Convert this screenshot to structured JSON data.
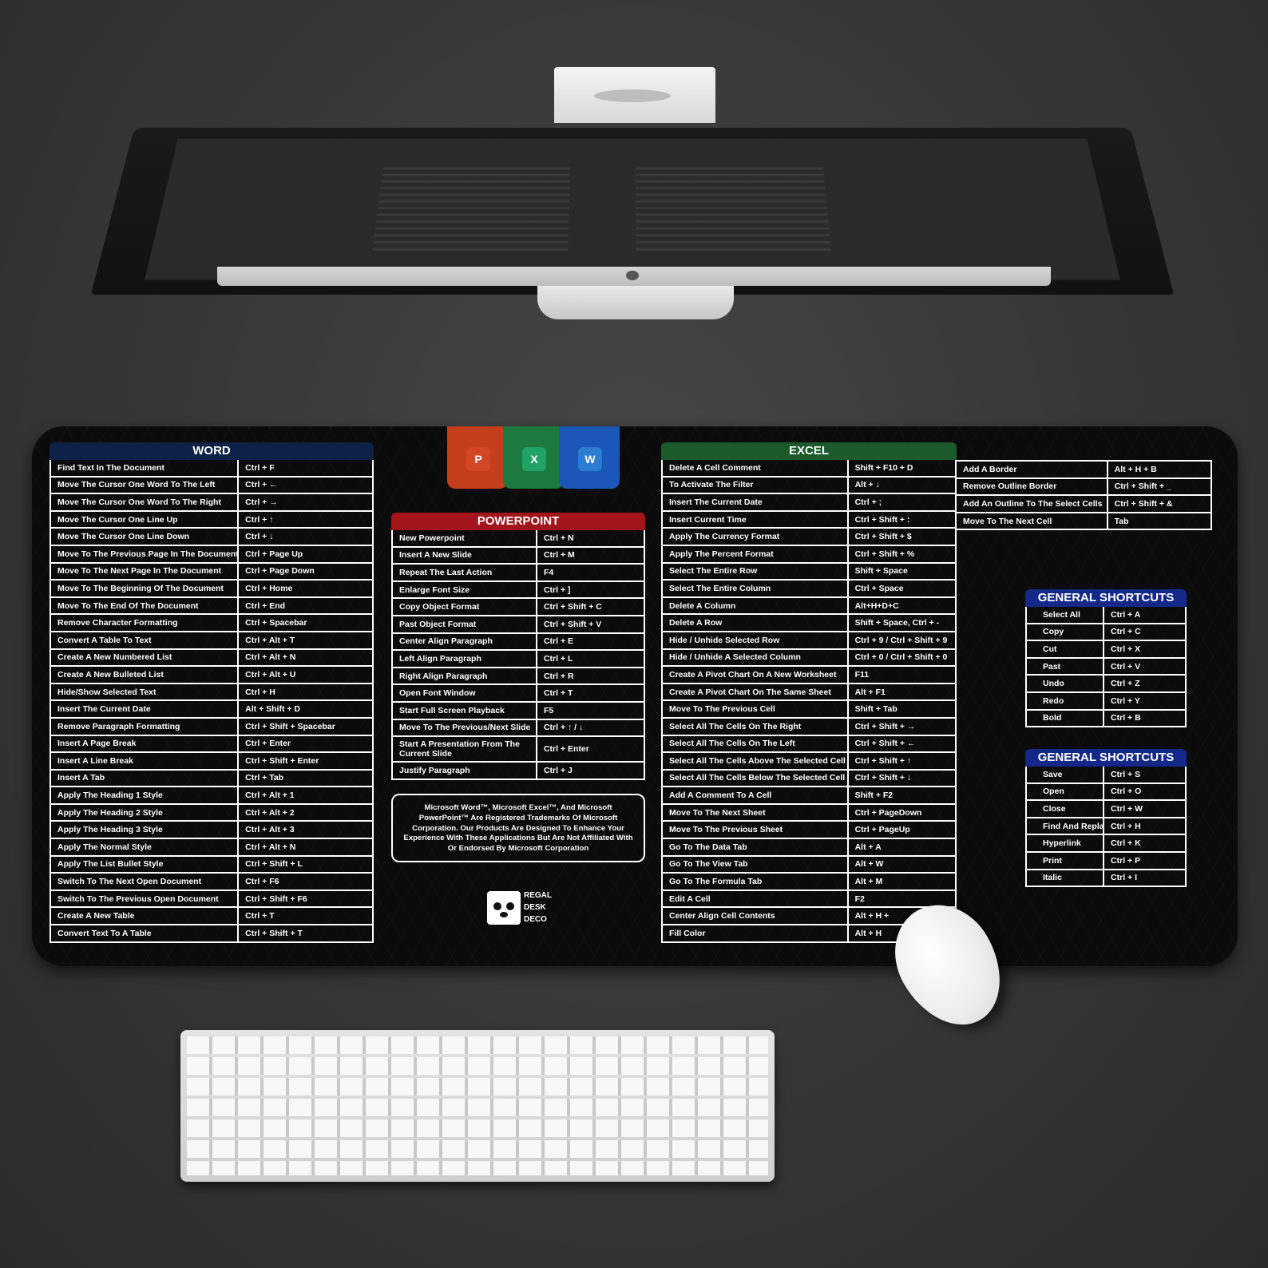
{
  "word": {
    "title": "WORD",
    "rows": [
      [
        "Find Text In The Document",
        "Ctrl + F"
      ],
      [
        "Move The Cursor One Word To The Left",
        "Ctrl + ←"
      ],
      [
        "Move The Cursor One Word To The Right",
        "Ctrl + →"
      ],
      [
        "Move The Cursor One Line Up",
        "Ctrl + ↑"
      ],
      [
        "Move The Cursor One Line Down",
        "Ctrl + ↓"
      ],
      [
        "Move To The Previous Page In The Document",
        "Ctrl + Page Up"
      ],
      [
        "Move To The Next Page In The Document",
        "Ctrl + Page Down"
      ],
      [
        "Move To The Beginning Of The Document",
        "Ctrl + Home"
      ],
      [
        "Move To The End Of The Document",
        "Ctrl + End"
      ],
      [
        "Remove Character Formatting",
        "Ctrl + Spacebar"
      ],
      [
        "Convert A Table To Text",
        "Ctrl + Alt + T"
      ],
      [
        "Create A New Numbered List",
        "Ctrl + Alt + N"
      ],
      [
        "Create A New Bulleted List",
        "Ctrl + Alt + U"
      ],
      [
        "Hide/Show Selected Text",
        "Ctrl + H"
      ],
      [
        "Insert The Current Date",
        "Alt + Shift + D"
      ],
      [
        "Remove Paragraph Formatting",
        "Ctrl + Shift + Spacebar"
      ],
      [
        "Insert A Page Break",
        "Ctrl + Enter"
      ],
      [
        "Insert A Line Break",
        "Ctrl + Shift + Enter"
      ],
      [
        "Insert A Tab",
        "Ctrl + Tab"
      ],
      [
        "Apply The Heading 1 Style",
        "Ctrl + Alt + 1"
      ],
      [
        "Apply The Heading 2 Style",
        "Ctrl + Alt + 2"
      ],
      [
        "Apply The Heading 3 Style",
        "Ctrl + Alt + 3"
      ],
      [
        "Apply The Normal Style",
        "Ctrl + Alt + N"
      ],
      [
        "Apply The List Bullet Style",
        "Ctrl + Shift + L"
      ],
      [
        "Switch To The Next Open Document",
        "Ctrl + F6"
      ],
      [
        "Switch To The Previous Open Document",
        "Ctrl + Shift + F6"
      ],
      [
        "Create A New Table",
        "Ctrl + T"
      ],
      [
        "Convert Text To A Table",
        "Ctrl + Shift + T"
      ]
    ]
  },
  "powerpoint": {
    "title": "POWERPOINT",
    "rows": [
      [
        "New Powerpoint",
        "Ctrl + N"
      ],
      [
        "Insert A New Slide",
        "Ctrl + M"
      ],
      [
        "Repeat The Last Action",
        "F4"
      ],
      [
        "Enlarge Font Size",
        "Ctrl + ]"
      ],
      [
        "Copy Object Format",
        "Ctrl + Shift + C"
      ],
      [
        "Past Object Format",
        "Ctrl + Shift + V"
      ],
      [
        "Center Align Paragraph",
        "Ctrl + E"
      ],
      [
        "Left Align Paragraph",
        "Ctrl + L"
      ],
      [
        "Right Align Paragraph",
        "Ctrl + R"
      ],
      [
        "Open Font Window",
        "Ctrl + T"
      ],
      [
        "Start Full Screen Playback",
        "F5"
      ],
      [
        "Move To The Previous/Next Slide",
        "Ctrl + ↑ / ↓"
      ],
      [
        "Start A Presentation From The Current Slide",
        "Ctrl + Enter"
      ],
      [
        "Justify Paragraph",
        "Ctrl + J"
      ]
    ]
  },
  "notice": "Microsoft Word™, Microsoft Excel™, And Microsoft PowerPoint™ Are Registered Trademarks Of Microsoft Corporation. Our Products Are Designed To Enhance Your Experience With These Applications But Are Not Affiliated With Or Endorsed By Microsoft Corporation",
  "brand": {
    "line1": "REGAL",
    "line2": "DESK",
    "line3": "DECO"
  },
  "app_icons": {
    "powerpoint": "P",
    "excel": "X",
    "word": "W"
  },
  "excel": {
    "title": "EXCEL",
    "rows": [
      [
        "Delete A Cell Comment",
        "Shift + F10 + D"
      ],
      [
        "To Activate The Filter",
        "Alt + ↓"
      ],
      [
        "Insert The Current Date",
        "Ctrl + ;"
      ],
      [
        "Insert Current Time",
        "Ctrl + Shift + :"
      ],
      [
        "Apply The Currency Format",
        "Ctrl + Shift + $"
      ],
      [
        "Apply The Percent Format",
        "Ctrl + Shift + %"
      ],
      [
        "Select The Entire Row",
        "Shift + Space"
      ],
      [
        "Select The Entire Column",
        "Ctrl + Space"
      ],
      [
        "Delete A Column",
        "Alt+H+D+C"
      ],
      [
        "Delete A Row",
        "Shift + Space, Ctrl + -"
      ],
      [
        "Hide / Unhide Selected Row",
        "Ctrl + 9 / Ctrl + Shift + 9"
      ],
      [
        "Hide / Unhide A Selected Column",
        "Ctrl + 0 / Ctrl + Shift + 0"
      ],
      [
        "Create A Pivot Chart On A New Worksheet",
        "F11"
      ],
      [
        "Create A Pivot Chart On The Same Sheet",
        "Alt + F1"
      ],
      [
        "Move To The Previous Cell",
        "Shift + Tab"
      ],
      [
        "Select All The Cells On The Right",
        "Ctrl + Shift + →"
      ],
      [
        "Select All The Cells On The Left",
        "Ctrl + Shift + ←"
      ],
      [
        "Select All The Cells Above The Selected Cell",
        "Ctrl + Shift + ↑"
      ],
      [
        "Select All The Cells Below The Selected Cell",
        "Ctrl + Shift + ↓"
      ],
      [
        "Add A Comment To A Cell",
        "Shift + F2"
      ],
      [
        "Move To The Next Sheet",
        "Ctrl + PageDown"
      ],
      [
        "Move To The Previous Sheet",
        "Ctrl + PageUp"
      ],
      [
        "Go To The Data Tab",
        "Alt + A"
      ],
      [
        "Go To The View Tab",
        "Alt + W"
      ],
      [
        "Go To The Formula Tab",
        "Alt + M"
      ],
      [
        "Edit A Cell",
        "F2"
      ],
      [
        "Center Align Cell Contents",
        "Alt + H +"
      ],
      [
        "Fill Color",
        "Alt + H"
      ]
    ],
    "extra_rows": [
      [
        "Add A Border",
        "Alt + H + B"
      ],
      [
        "Remove Outline Border",
        "Ctrl + Shift + _"
      ],
      [
        "Add An Outline To The Select Cells",
        "Ctrl + Shift + &"
      ],
      [
        "Move To The Next Cell",
        "Tab"
      ]
    ]
  },
  "general1": {
    "title": "GENERAL SHORTCUTS",
    "rows": [
      [
        "Select All",
        "Ctrl + A"
      ],
      [
        "Copy",
        "Ctrl + C"
      ],
      [
        "Cut",
        "Ctrl + X"
      ],
      [
        "Past",
        "Ctrl + V"
      ],
      [
        "Undo",
        "Ctrl + Z"
      ],
      [
        "Redo",
        "Ctrl + Y"
      ],
      [
        "Bold",
        "Ctrl + B"
      ]
    ]
  },
  "general2": {
    "title": "GENERAL SHORTCUTS",
    "rows": [
      [
        "Save",
        "Ctrl + S"
      ],
      [
        "Open",
        "Ctrl + O"
      ],
      [
        "Close",
        "Ctrl + W"
      ],
      [
        "Find And Replace",
        "Ctrl + H"
      ],
      [
        "Hyperlink",
        "Ctrl + K"
      ],
      [
        "Print",
        "Ctrl + P"
      ],
      [
        "Italic",
        "Ctrl + I"
      ]
    ]
  },
  "colors": {
    "word_header": "#0e2247",
    "powerpoint_header": "#a3141b",
    "excel_header": "#1c5a2c",
    "general_header": "#14288a",
    "pp_icon": "#c43e1c",
    "xl_icon": "#1d7a3f",
    "wd_icon": "#1b57b8"
  }
}
